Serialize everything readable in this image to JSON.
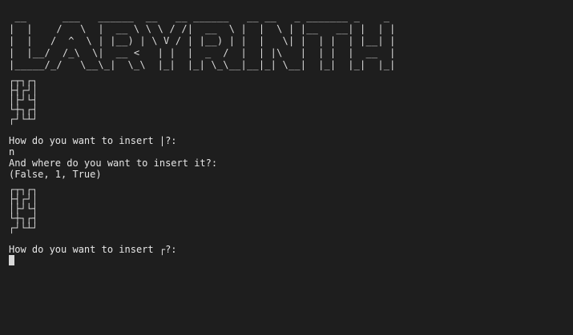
{
  "terminal": {
    "banner": [
      " __      ___   ______  __   __ ______   __ __   _ _______ _    _ ",
      "|  |    /   \\  |  __ \\ \\ \\ / /|  __  \\ |  |  \\ | |__   __| |  | |",
      "|  |   /  ^  \\ | |__) | \\ V / | |__) | |  |   \\| |  | |  | |__| |",
      "|  |__/  /_\\  \\|  __ <   | |  |  _  /  |  | |\\   |  | |  |  __  |",
      "|_____/_/   \\__\\_|  \\_\\  |_|  |_| \\_\\__|__|_| \\__|  |_|  |_|  |_|"
    ],
    "maze1": [
      "┌┬┐┌┐",
      "├┤┌┘│",
      "│├┘└┤",
      "└┼┐┌┤",
      "┌┘└┴┘"
    ],
    "prompt1": "How do you want to insert |?:",
    "answer1": "n",
    "prompt2": "And where do you want to insert it?:",
    "answer2": "(False, 1, True)",
    "maze2": [
      "┌┬┐┌┐",
      "├┤┌┘│",
      "│├┘└┤",
      "└┼┐┌┤",
      "┌┘└┴┘"
    ],
    "prompt3": "How do you want to insert ┌?:",
    "input_value": ""
  }
}
